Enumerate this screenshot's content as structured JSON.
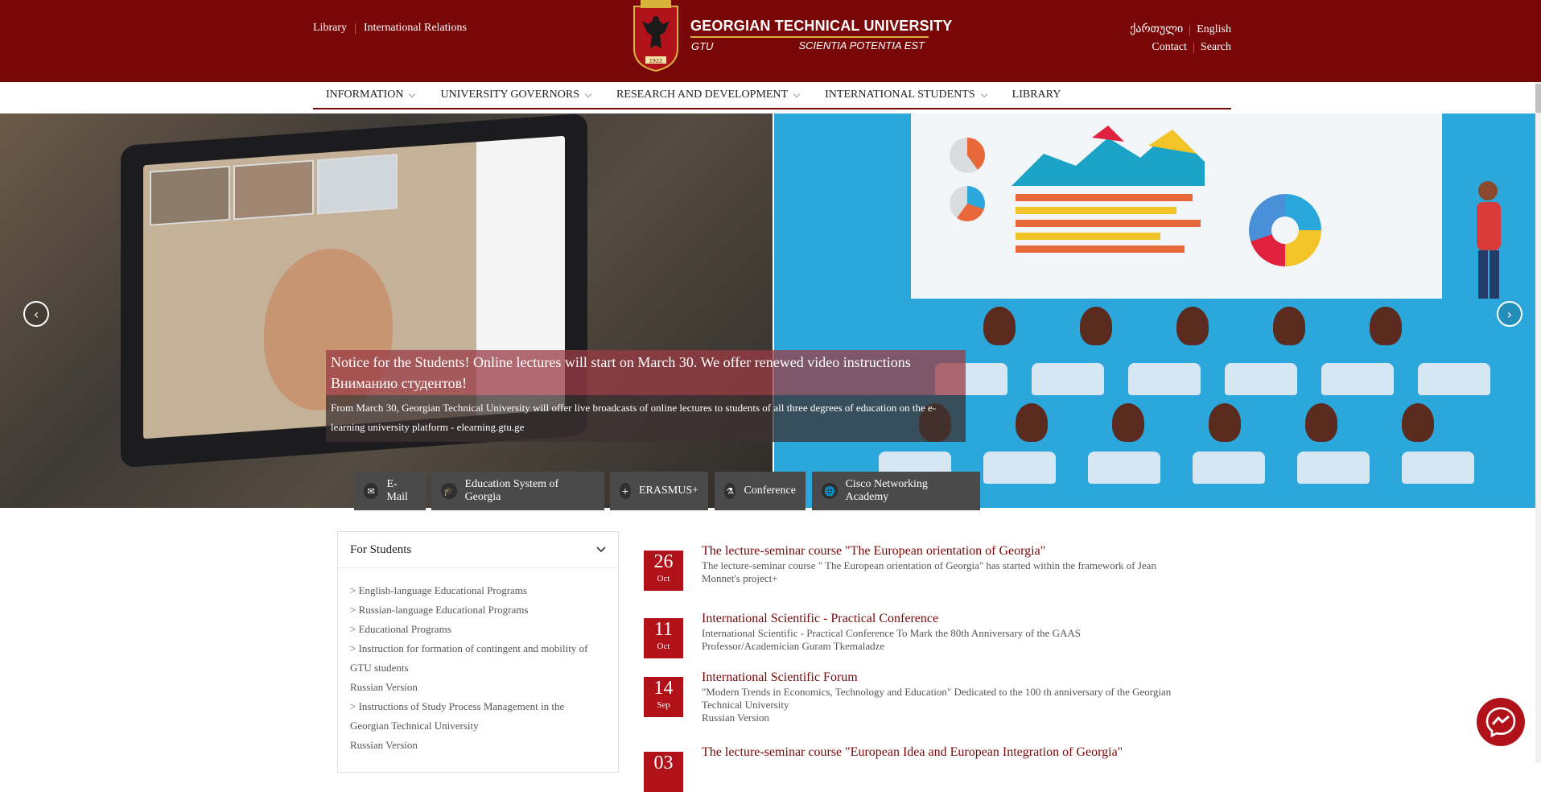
{
  "header": {
    "left_links": [
      "Library",
      "International Relations"
    ],
    "lang_links": [
      "ქართული",
      "English"
    ],
    "right_links": [
      "Contact",
      "Search"
    ],
    "university_name": "GEORGIAN TECHNICAL UNIVERSITY",
    "abbr": "GTU",
    "motto": "SCIENTIA POTENTIA EST",
    "emblem_text": "1922"
  },
  "nav": [
    {
      "label": "INFORMATION",
      "has_dropdown": true
    },
    {
      "label": "UNIVERSITY GOVERNORS",
      "has_dropdown": true
    },
    {
      "label": "RESEARCH AND DEVELOPMENT",
      "has_dropdown": true
    },
    {
      "label": "INTERNATIONAL STUDENTS",
      "has_dropdown": true
    },
    {
      "label": "LIBRARY",
      "has_dropdown": false
    }
  ],
  "slider": {
    "title_line1": "Notice for the Students! Online lectures will start on March 30. We offer renewed video instructions",
    "title_line2": "Вниманию студентов!",
    "text": "From March 30, Georgian Technical University will offer live broadcasts of online lectures to students of all three degrees of education on the e-learning university platform - elearning.gtu.ge",
    "prev_icon": "chevron-left-icon",
    "next_icon": "chevron-right-icon"
  },
  "quick_links": [
    {
      "label": "E-Mail",
      "icon": "envelope-icon"
    },
    {
      "label": "Education System of Georgia",
      "icon": "graduation-cap-icon"
    },
    {
      "label": "ERASMUS+",
      "icon": "plus-circle-icon"
    },
    {
      "label": "Conference",
      "icon": "flask-icon"
    },
    {
      "label": "Cisco Networking Academy",
      "icon": "globe-icon"
    }
  ],
  "students": {
    "title": "For Students",
    "items": [
      "> English-language Educational Programs",
      "> Russian-language Educational Programs",
      "> Educational Programs",
      "> Instruction for formation of contingent and mobility of",
      "GTU students",
      "Russian Version",
      "> Instructions of Study Process Management in the",
      "Georgian Technical University",
      "Russian Version"
    ]
  },
  "news": [
    {
      "day": "26",
      "month": "Oct",
      "title": "The lecture-seminar course \"The European orientation of Georgia\"",
      "text": "The lecture-seminar course \" The European orientation of Georgia\" has started within the framework of Jean Monnet's project+"
    },
    {
      "day": "11",
      "month": "Oct",
      "title": "International Scientific - Practical Conference",
      "text": "International Scientific - Practical Conference  To Mark the 80th Anniversary of the GAAS Professor/Academician Guram Tkemaladze"
    },
    {
      "day": "14",
      "month": "Sep",
      "title": "International Scientific Forum",
      "text": "\"Modern Trends in Economics, Technology and Education\" Dedicated to the 100 th anniversary of the Georgian Technical University",
      "extra": "Russian Version"
    },
    {
      "day": "03",
      "month": "",
      "title": "The lecture-seminar course \"European Idea and European Integration of Georgia\"",
      "text": ""
    }
  ],
  "colors": {
    "brand": "#7a0708",
    "date_badge": "#b1121a"
  }
}
